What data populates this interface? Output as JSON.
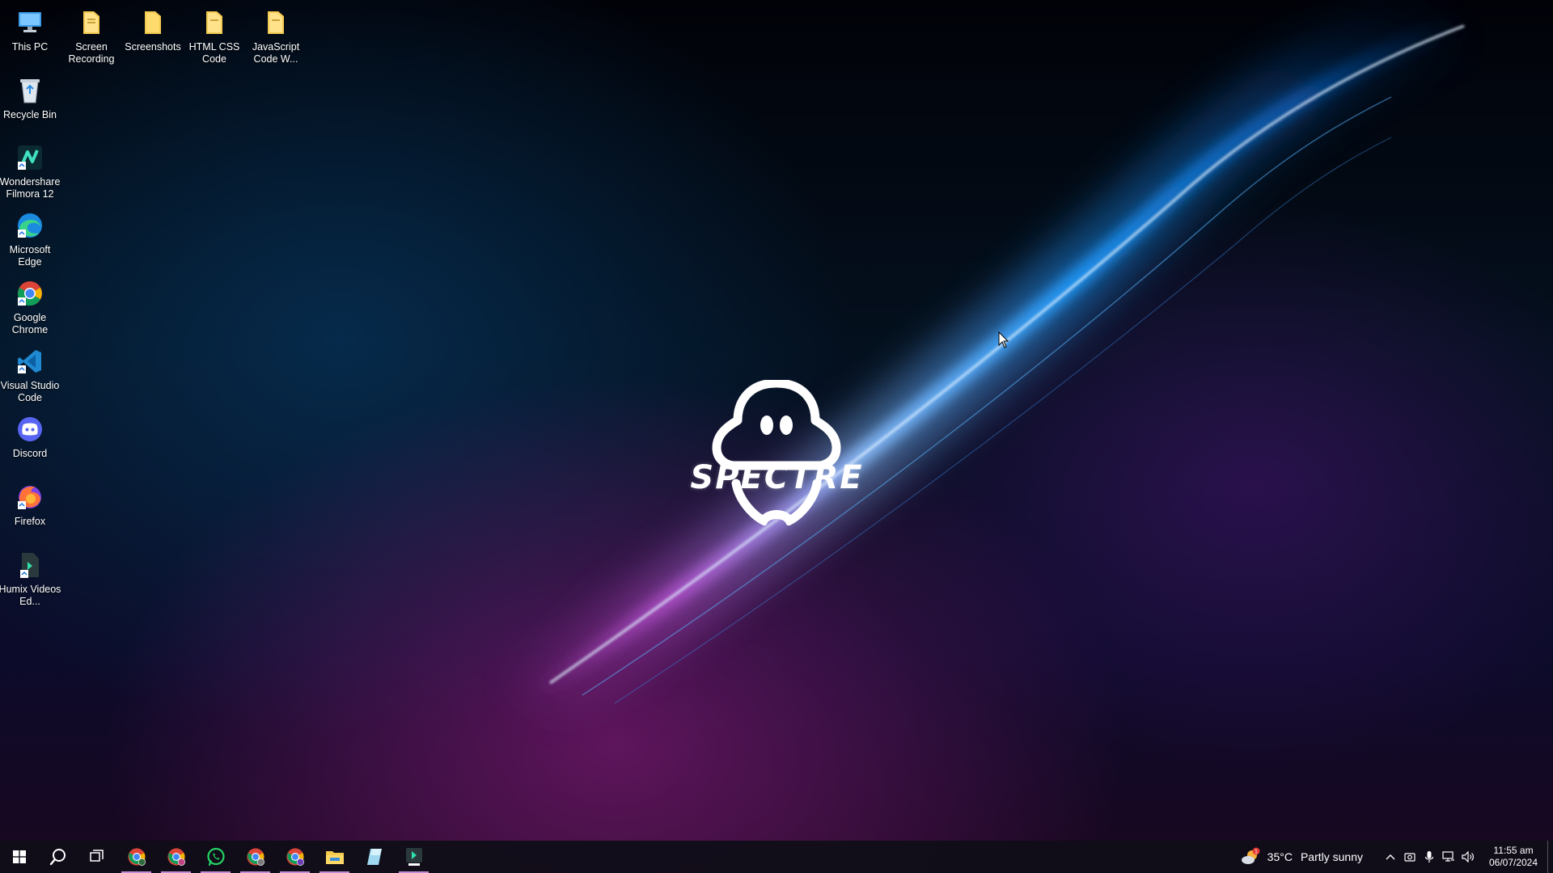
{
  "desktop_icons": [
    {
      "id": "this-pc",
      "label": "This PC",
      "icon": "computer-icon"
    },
    {
      "id": "screen-recording",
      "label": "Screen Recording",
      "icon": "folder-icon"
    },
    {
      "id": "screenshots",
      "label": "Screenshots",
      "icon": "folder-icon"
    },
    {
      "id": "html-css-code",
      "label": "HTML CSS Code",
      "icon": "folder-icon"
    },
    {
      "id": "javascript-code",
      "label": "JavaScript Code W...",
      "icon": "folder-icon"
    },
    {
      "id": "recycle-bin",
      "label": "Recycle Bin",
      "icon": "recycle-bin-icon"
    },
    {
      "id": "filmora",
      "label": "Wondershare Filmora 12",
      "icon": "filmora-icon"
    },
    {
      "id": "edge",
      "label": "Microsoft Edge",
      "icon": "edge-icon"
    },
    {
      "id": "chrome",
      "label": "Google Chrome",
      "icon": "chrome-icon"
    },
    {
      "id": "vscode",
      "label": "Visual Studio Code",
      "icon": "vscode-icon"
    },
    {
      "id": "discord",
      "label": "Discord",
      "icon": "discord-icon"
    },
    {
      "id": "firefox",
      "label": "Firefox",
      "icon": "firefox-icon"
    },
    {
      "id": "humix",
      "label": "Humix Videos Ed...",
      "icon": "humix-icon"
    }
  ],
  "wallpaper": {
    "logo_text": "SPECTRE"
  },
  "taskbar": {
    "start": "windows-logo-icon",
    "search": "search-icon",
    "task_view": "task-view-icon",
    "apps": [
      {
        "id": "chrome-profile-1",
        "icon": "chrome-icon"
      },
      {
        "id": "chrome-profile-2",
        "icon": "chrome-icon"
      },
      {
        "id": "whatsapp",
        "icon": "whatsapp-icon"
      },
      {
        "id": "chrome-profile-3",
        "icon": "chrome-icon"
      },
      {
        "id": "chrome-profile-4",
        "icon": "chrome-icon"
      },
      {
        "id": "file-explorer",
        "icon": "folder-icon"
      },
      {
        "id": "notepad",
        "icon": "notepad-icon"
      },
      {
        "id": "humix-app",
        "icon": "humix-icon"
      }
    ],
    "tray": {
      "weather_temp": "35°C",
      "weather_condition": "Partly sunny",
      "weather_badge": "1",
      "time": "11:55 am",
      "date": "06/07/2024"
    }
  },
  "colors": {
    "taskbar_bg": "#100e18",
    "active_underline": "#c48ed6",
    "folder_yellow": "#f3c94f"
  }
}
